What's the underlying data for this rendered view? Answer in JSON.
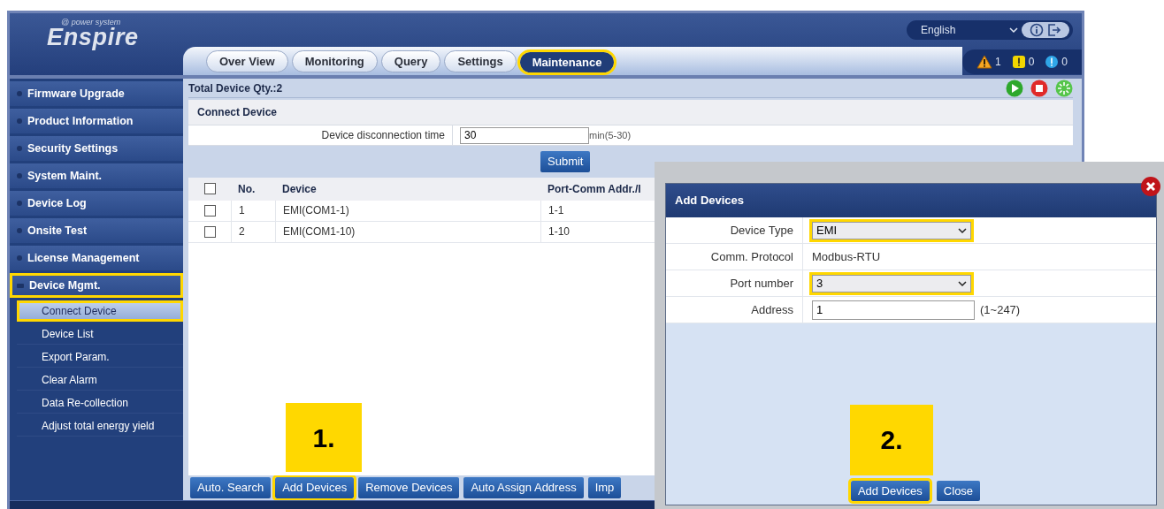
{
  "header": {
    "logo": {
      "brand": "Enspire",
      "tagline": "@ power system"
    },
    "language": "English",
    "tabs": [
      {
        "label": "Over View",
        "selected": false,
        "highlighted": false
      },
      {
        "label": "Monitoring",
        "selected": false,
        "highlighted": false
      },
      {
        "label": "Query",
        "selected": false,
        "highlighted": false
      },
      {
        "label": "Settings",
        "selected": false,
        "highlighted": false
      },
      {
        "label": "Maintenance",
        "selected": true,
        "highlighted": true
      }
    ],
    "alarms": [
      {
        "kind": "major",
        "count": "1"
      },
      {
        "kind": "minor",
        "count": "0"
      },
      {
        "kind": "warning",
        "count": "0"
      }
    ]
  },
  "sidebar": {
    "items": [
      {
        "label": "Firmware Upgrade",
        "expanded": false,
        "highlighted": false
      },
      {
        "label": "Product Information",
        "expanded": false,
        "highlighted": false
      },
      {
        "label": "Security Settings",
        "expanded": false,
        "highlighted": false
      },
      {
        "label": "System Maint.",
        "expanded": false,
        "highlighted": false
      },
      {
        "label": "Device Log",
        "expanded": false,
        "highlighted": false
      },
      {
        "label": "Onsite Test",
        "expanded": false,
        "highlighted": false
      },
      {
        "label": "License Management",
        "expanded": false,
        "highlighted": false
      },
      {
        "label": "Device Mgmt.",
        "expanded": true,
        "highlighted": true,
        "children": [
          {
            "label": "Connect Device",
            "selected": true,
            "highlighted": true
          },
          {
            "label": "Device List",
            "selected": false,
            "highlighted": false
          },
          {
            "label": "Export Param.",
            "selected": false,
            "highlighted": false
          },
          {
            "label": "Clear Alarm",
            "selected": false,
            "highlighted": false
          },
          {
            "label": "Data Re-collection",
            "selected": false,
            "highlighted": false
          },
          {
            "label": "Adjust total energy yield",
            "selected": false,
            "highlighted": false
          }
        ]
      }
    ]
  },
  "content": {
    "total": "Total Device Qty.:2",
    "section_title": "Connect Device",
    "field": {
      "label": "Device disconnection time",
      "value": "30",
      "hint": "min(5-30)"
    },
    "submit": "Submit",
    "table": {
      "header_checked": false,
      "columns": [
        "No.",
        "Device",
        "Port-Comm Addr./I"
      ],
      "rows": [
        {
          "checked": false,
          "cells": [
            "1",
            "EMI(COM1-1)",
            "1-1"
          ]
        },
        {
          "checked": false,
          "cells": [
            "2",
            "EMI(COM1-10)",
            "1-10"
          ]
        }
      ]
    },
    "step": "1.",
    "buttons": [
      {
        "label": "Auto. Search",
        "highlighted": false
      },
      {
        "label": "Add Devices",
        "highlighted": true
      },
      {
        "label": "Remove Devices",
        "highlighted": false
      },
      {
        "label": "Auto Assign Address",
        "highlighted": false
      },
      {
        "label": "Imp",
        "highlighted": false
      }
    ]
  },
  "dialog": {
    "title": "Add Devices",
    "rows": [
      {
        "kind": "select",
        "label": "Device Type",
        "value": "EMI",
        "highlighted": true
      },
      {
        "kind": "text",
        "label": "Comm. Protocol",
        "value": "Modbus-RTU"
      },
      {
        "kind": "select",
        "label": "Port number",
        "value": "3",
        "highlighted": true
      },
      {
        "kind": "input",
        "label": "Address",
        "value": "1",
        "hint": "(1~247)"
      }
    ],
    "step": "2.",
    "buttons": [
      {
        "label": "Add Devices",
        "highlighted": true
      },
      {
        "label": "Close",
        "highlighted": false
      }
    ]
  }
}
